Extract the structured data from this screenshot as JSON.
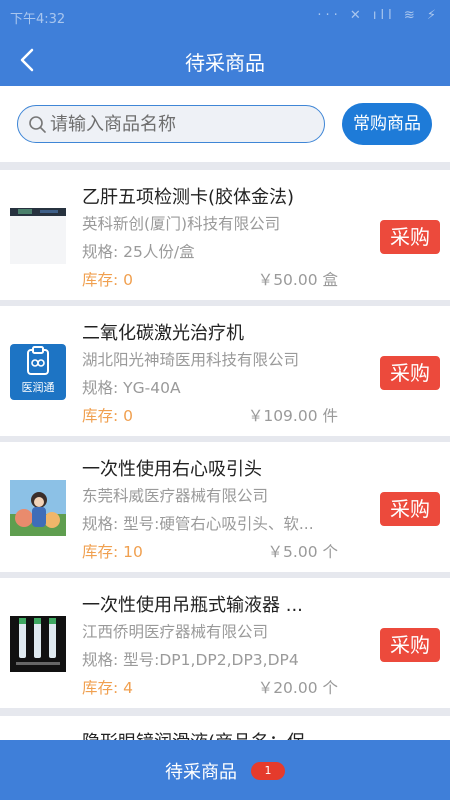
{
  "status_bar": {
    "time": "下午4:32",
    "icons": "··· ✕ ıll ≋ ⚡"
  },
  "nav": {
    "title": "待采商品"
  },
  "search": {
    "placeholder": "请输入商品名称",
    "frequent_label": "常购商品"
  },
  "products": [
    {
      "name": "乙肝五项检测卡(胶体金法)",
      "maker": "英科新创(厦门)科技有限公司",
      "spec": "规格: 25人份/盒",
      "stock": "库存: 0",
      "price": "￥50.00 盒",
      "buy_label": "采购",
      "thumb": "test-kit-image"
    },
    {
      "name": "二氧化碳激光治疗机",
      "maker": "湖北阳光神琦医用科技有限公司",
      "spec": "规格: YG-40A",
      "stock": "库存: 0",
      "price": "￥109.00 件",
      "buy_label": "采购",
      "thumb": "yirunton-logo",
      "thumb_text": "医润通"
    },
    {
      "name": "一次性使用右心吸引头",
      "maker": "东莞科威医疗器械有限公司",
      "spec": "规格: 型号:硬管右心吸引头、软...",
      "stock": "库存: 10",
      "price": "￥5.00 个",
      "buy_label": "采购",
      "thumb": "illustration-image"
    },
    {
      "name": "一次性使用吊瓶式输液器 ...",
      "maker": "江西侨明医疗器械有限公司",
      "spec": "规格: 型号:DP1,DP2,DP3,DP4",
      "stock": "库存: 4",
      "price": "￥20.00 个",
      "buy_label": "采购",
      "thumb": "infusion-set-image"
    }
  ],
  "partial_item": {
    "name": "隐形眼镜润滑液(商品名：保"
  },
  "bottom_bar": {
    "label": "待采商品",
    "badge": "1"
  },
  "colors": {
    "primary": "#3f7fd9",
    "buy": "#ec4a3c",
    "stock": "#f0a050",
    "button": "#1e7bd8"
  }
}
